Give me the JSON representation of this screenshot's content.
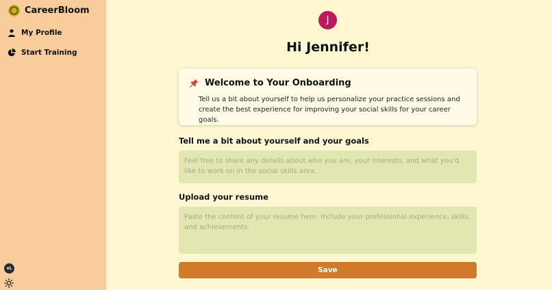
{
  "app": {
    "name": "CareerBloom",
    "logo_icon": "flower-logo-icon"
  },
  "sidebar": {
    "items": [
      {
        "label": "My Profile",
        "icon": "user-icon"
      },
      {
        "label": "Start Training",
        "icon": "pie-chart-icon"
      }
    ],
    "footer_badge": "xL",
    "theme_toggle_icon": "sun-icon"
  },
  "header": {
    "avatar_initial": "J",
    "avatar_color": "#c2185b",
    "greeting": "Hi Jennifer!"
  },
  "welcome_card": {
    "icon": "pushpin-icon",
    "title": "Welcome to Your Onboarding",
    "body": "Tell us a bit about yourself to help us personalize your practice sessions and create the best experience for improving your social skills for your career goals."
  },
  "form": {
    "about": {
      "label": "Tell me a bit about yourself and your goals",
      "value": "",
      "placeholder": "Feel free to share any details about who you are, your interests, and what you'd like to work on in the social skills area."
    },
    "resume": {
      "label": "Upload your resume",
      "value": "",
      "placeholder": "Paste the content of your resume here. Include your professional experience, skills, and achievements."
    },
    "save_label": "Save"
  },
  "colors": {
    "sidebar_bg": "#f9cc9b",
    "main_bg": "#fef7d2",
    "accent": "#d17a2a",
    "input_bg": "#e2e6b1"
  }
}
